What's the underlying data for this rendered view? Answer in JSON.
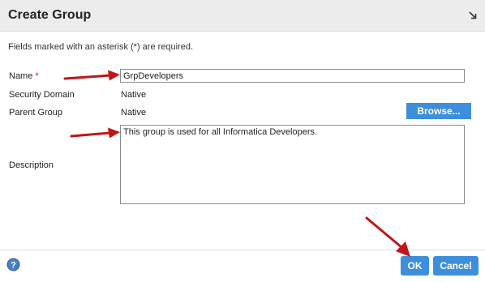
{
  "dialog": {
    "title": "Create Group",
    "collapse_icon": "collapse-arrow-icon",
    "instructions": "Fields marked with an asterisk (*) are required."
  },
  "form": {
    "name": {
      "label": "Name",
      "required_marker": "*",
      "value": "GrpDevelopers"
    },
    "security_domain": {
      "label": "Security Domain",
      "value": "Native"
    },
    "parent_group": {
      "label": "Parent Group",
      "value": "Native",
      "browse_label": "Browse..."
    },
    "description": {
      "label": "Description",
      "value": "This group is used for all Informatica Developers."
    }
  },
  "footer": {
    "help_icon": "help-question-icon",
    "ok_label": "OK",
    "cancel_label": "Cancel"
  },
  "annotations": {
    "arrow_icon": "red-arrow-icon",
    "color": "#c0161a"
  },
  "colors": {
    "accent": "#3d8fdc",
    "titlebar": "#ececec",
    "required": "#d9261c"
  }
}
